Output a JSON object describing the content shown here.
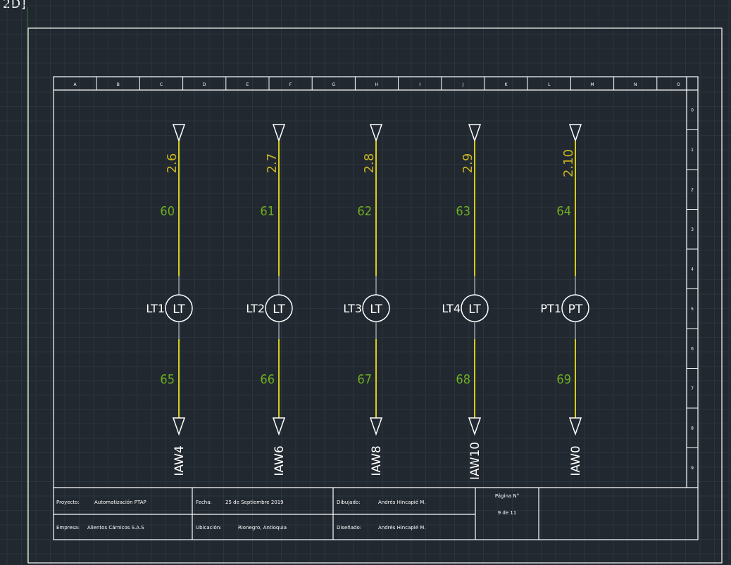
{
  "viewport_label": "2D]",
  "column_headers": [
    "A",
    "B",
    "C",
    "D",
    "E",
    "F",
    "G",
    "H",
    "I",
    "J",
    "K",
    "L",
    "M",
    "N",
    "O"
  ],
  "row_headers": [
    "0",
    "1",
    "2",
    "3",
    "4",
    "5",
    "6",
    "7",
    "8",
    "9"
  ],
  "instruments": [
    {
      "tag": "LT1",
      "symbol": "LT",
      "address": "2.6",
      "wire_top": "60",
      "wire_bottom": "65",
      "io": "IAW4"
    },
    {
      "tag": "LT2",
      "symbol": "LT",
      "address": "2.7",
      "wire_top": "61",
      "wire_bottom": "66",
      "io": "IAW6"
    },
    {
      "tag": "LT3",
      "symbol": "LT",
      "address": "2.8",
      "wire_top": "62",
      "wire_bottom": "67",
      "io": "IAW8"
    },
    {
      "tag": "LT4",
      "symbol": "LT",
      "address": "2.9",
      "wire_top": "63",
      "wire_bottom": "68",
      "io": "IAW10"
    },
    {
      "tag": "PT1",
      "symbol": "PT",
      "address": "2.10",
      "wire_top": "64",
      "wire_bottom": "69",
      "io": "IAW0"
    }
  ],
  "title_block": {
    "proyecto_label": "Proyecto:",
    "proyecto_value": "Automatización PTAP",
    "empresa_label": "Empresa:",
    "empresa_value": "Alientos Cárnicos S.A.S",
    "fecha_label": "Fecha:",
    "fecha_value": "25 de Septiembre 2019",
    "ubicacion_label": "Ubicación:",
    "ubicacion_value": "Rionegro, Antioquia",
    "dibujado_label": "Dibujado:",
    "dibujado_value": "Andrés Hincapié M.",
    "disenado_label": "Diseñado:",
    "disenado_value": "Andrés Hincapié M.",
    "pagina_label": "Página N°",
    "pagina_value": "9 de 11"
  },
  "colors": {
    "background": "#212830",
    "grid": "#2c3540",
    "frame": "#ffffff",
    "wire": "#d4cc1e",
    "wire_number": "#6fae1f",
    "address": "#c9b420"
  }
}
